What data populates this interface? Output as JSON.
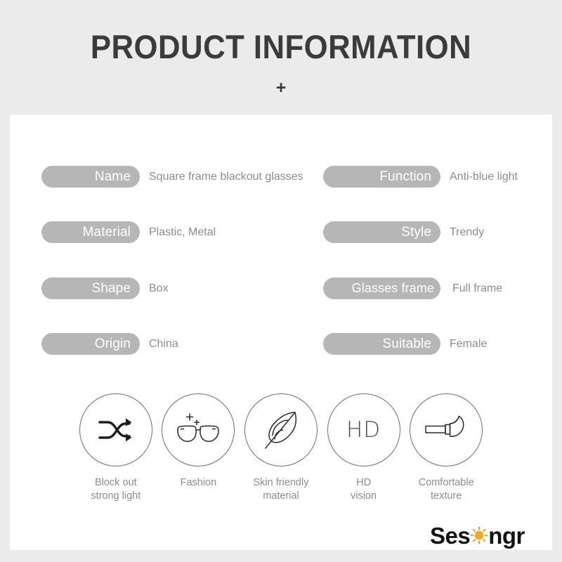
{
  "header": {
    "title": "PRODUCT INFORMATION",
    "divider": "+"
  },
  "colors": {
    "page_background": "#ebebeb",
    "card_background": "#ffffff",
    "pill_background": "#b6b6b6",
    "pill_text": "#ffffff",
    "value_text": "#8c8c8c",
    "title_text": "#3b3b3b",
    "icon_stroke": "#6d6d6d",
    "logo_text": "#121212",
    "logo_accent": "#f5a623"
  },
  "specs": {
    "left_column": [
      {
        "label": "Name",
        "value": "Square frame blackout glasses"
      },
      {
        "label": "Material",
        "value": "Plastic, Metal"
      },
      {
        "label": "Shape",
        "value": "Box"
      },
      {
        "label": "Origin",
        "value": "China"
      }
    ],
    "right_column": [
      {
        "label": "Function",
        "value": "Anti-blue light"
      },
      {
        "label": "Style",
        "value": "Trendy"
      },
      {
        "label": "Glasses frame",
        "value": "Full frame"
      },
      {
        "label": "Suitable",
        "value": "Female"
      }
    ]
  },
  "features": [
    {
      "icon": "shuffle-arrows-icon",
      "caption": "Block out\nstrong light"
    },
    {
      "icon": "eyeglasses-sparkle-icon",
      "caption": "Fashion"
    },
    {
      "icon": "feather-icon",
      "caption": "Skin friendly\nmaterial"
    },
    {
      "icon": "hd-text-icon",
      "caption": "HD\nvision",
      "label": "HD"
    },
    {
      "icon": "hammer-icon",
      "caption": "Comfortable\ntexture"
    }
  ],
  "logo": {
    "prefix": "Ses",
    "sun_icon": "sun-icon",
    "suffix": "ngr",
    "full_text": "Sesongr"
  }
}
